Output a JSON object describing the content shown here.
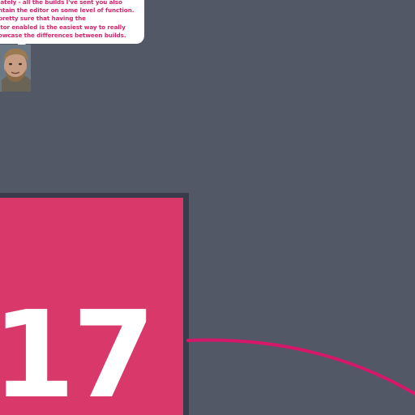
{
  "speech_bubble": {
    "lines": [
      "lately - all the builds I've sent you also",
      "ntain the editor on some level of function.",
      "pretty sure that having the",
      "itor enabled is the easiest way to really",
      "owcase the differences between builds."
    ]
  },
  "level": {
    "number": "17"
  },
  "colors": {
    "background": "#535866",
    "card": "#d9386a",
    "card_shadow": "#3a3c4c",
    "text_accent": "#d6246c",
    "path": "#d6186a"
  }
}
